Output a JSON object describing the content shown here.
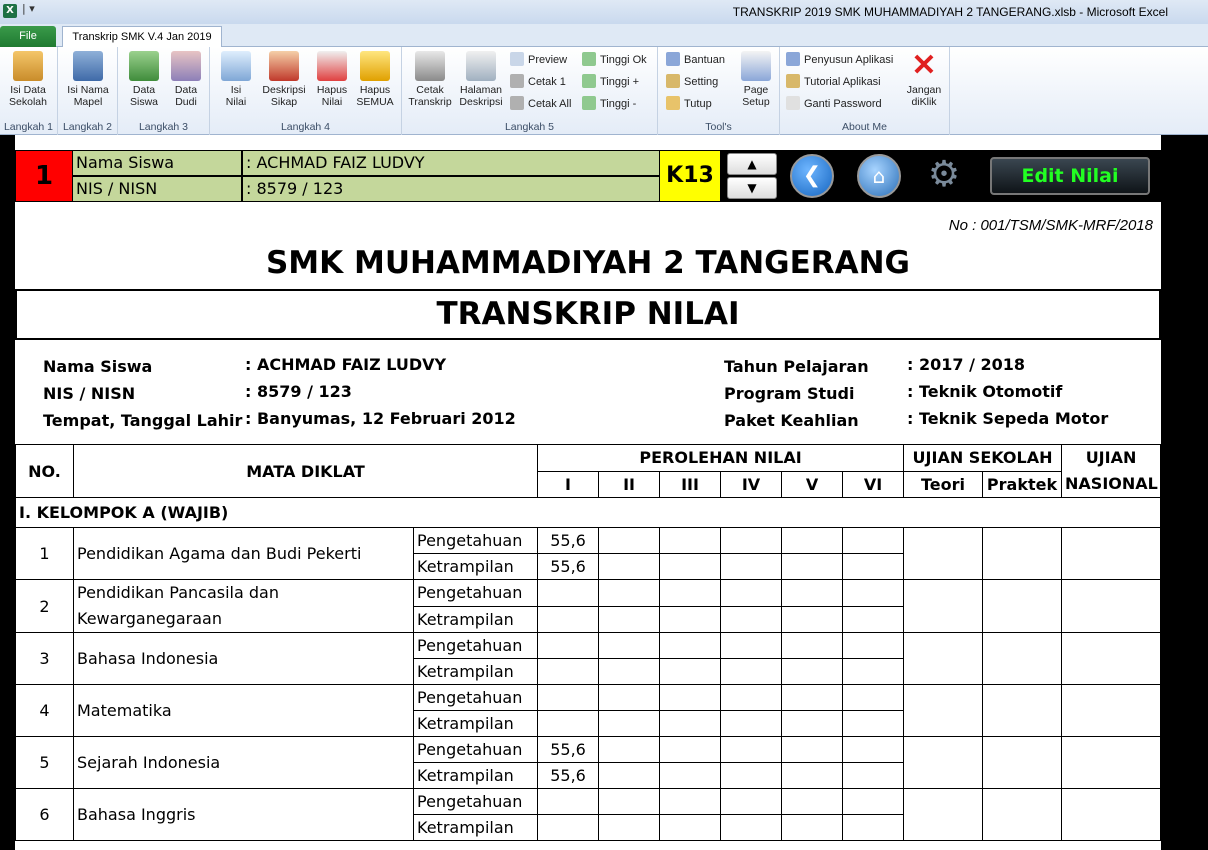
{
  "window": {
    "title": "TRANSKRIP 2019 SMK MUHAMMADIYAH 2 TANGERANG.xlsb  -  Microsoft Excel",
    "app_icon": "excel-icon"
  },
  "ribbon_tabs": {
    "file": "File",
    "active": "Transkrip SMK V.4 Jan 2019"
  },
  "ribbon": {
    "groups": [
      {
        "label": "Langkah 1",
        "buttons": [
          "Isi Data\nSekolah"
        ]
      },
      {
        "label": "Langkah 2",
        "buttons": [
          "Isi Nama\nMapel"
        ]
      },
      {
        "label": "Langkah 3",
        "buttons": [
          "Data\nSiswa",
          "Data\nDudi"
        ]
      },
      {
        "label": "Langkah 4",
        "buttons": [
          "Isi\nNilai",
          "Deskripsi\nSikap",
          "Hapus\nNilai",
          "Hapus\nSEMUA"
        ]
      },
      {
        "label": "Langkah 5",
        "buttons": [
          "Cetak\nTranskrip",
          "Halaman\nDeskripsi"
        ],
        "small": [
          "Preview",
          "Cetak 1",
          "Cetak All",
          "Tinggi Ok",
          "Tinggi +",
          "Tinggi -"
        ]
      },
      {
        "label": "Tool's",
        "small": [
          "Bantuan",
          "Setting",
          "Tutup"
        ],
        "buttons": [
          "Page\nSetup"
        ]
      },
      {
        "label": "About Me",
        "small": [
          "Penyusun Aplikasi",
          "Tutorial Aplikasi",
          "Ganti Password"
        ],
        "buttons": [
          "Jangan\ndiKlik"
        ]
      }
    ]
  },
  "header_bar": {
    "number": "1",
    "name_label": "Nama Siswa",
    "name_value": ": ACHMAD FAIZ LUDVY",
    "nis_label": "NIS / NISN",
    "nis_value": ": 8579 / 123",
    "curriculum": "K13",
    "edit_button": "Edit Nilai",
    "icons": [
      "chevron-up-icon",
      "chevron-down-icon",
      "back-arrow-icon",
      "home-icon",
      "gear-icon"
    ]
  },
  "document": {
    "doc_number": "No : 001/TSM/SMK-MRF/2018",
    "school": "SMK MUHAMMADIYAH 2 TANGERANG",
    "title": "TRANSKRIP NILAI",
    "student": {
      "name_label": "Nama Siswa",
      "name_value": ": ACHMAD FAIZ LUDVY",
      "nis_label": "NIS / NISN",
      "nis_value": ": 8579 / 123",
      "birth_label": "Tempat, Tanggal Lahir",
      "birth_value": ": Banyumas, 12 Februari 2012",
      "year_label": "Tahun Pelajaran",
      "year_value": ": 2017 / 2018",
      "program_label": "Program Studi",
      "program_value": ": Teknik Otomotif",
      "package_label": "Paket Keahlian",
      "package_value": ": Teknik Sepeda Motor"
    }
  },
  "table": {
    "headers": {
      "no": "NO.",
      "subject": "MATA DIKLAT",
      "perolehan": "PEROLEHAN NILAI",
      "semesters": [
        "I",
        "II",
        "III",
        "IV",
        "V",
        "VI"
      ],
      "ujian_sekolah": "UJIAN SEKOLAH",
      "teori": "Teori",
      "praktek": "Praktek",
      "ujian": "UJIAN",
      "nasional": "NASIONAL"
    },
    "group_label": "I. KELOMPOK A (WAJIB)",
    "aspect_labels": [
      "Pengetahuan",
      "Ketrampilan"
    ],
    "subjects": [
      {
        "no": "1",
        "name1": "Pendidikan Agama dan Budi Pekerti",
        "name2": "",
        "p": [
          "55,6",
          "",
          "",
          "",
          "",
          ""
        ],
        "k": [
          "55,6",
          "",
          "",
          "",
          "",
          ""
        ]
      },
      {
        "no": "2",
        "name1": "Pendidikan Pancasila dan",
        "name2": "Kewarganegaraan",
        "p": [
          "",
          "",
          "",
          "",
          "",
          ""
        ],
        "k": [
          "",
          "",
          "",
          "",
          "",
          ""
        ]
      },
      {
        "no": "3",
        "name1": "Bahasa Indonesia",
        "name2": "",
        "p": [
          "",
          "",
          "",
          "",
          "",
          ""
        ],
        "k": [
          "",
          "",
          "",
          "",
          "",
          ""
        ]
      },
      {
        "no": "4",
        "name1": "Matematika",
        "name2": "",
        "p": [
          "",
          "",
          "",
          "",
          "",
          ""
        ],
        "k": [
          "",
          "",
          "",
          "",
          "",
          ""
        ]
      },
      {
        "no": "5",
        "name1": "Sejarah Indonesia",
        "name2": "",
        "p": [
          "55,6",
          "",
          "",
          "",
          "",
          ""
        ],
        "k": [
          "55,6",
          "",
          "",
          "",
          "",
          ""
        ]
      },
      {
        "no": "6",
        "name1": "Bahasa Inggris",
        "name2": "",
        "p": [
          "",
          "",
          "",
          "",
          "",
          ""
        ],
        "k": [
          "",
          "",
          "",
          "",
          "",
          ""
        ]
      }
    ]
  }
}
